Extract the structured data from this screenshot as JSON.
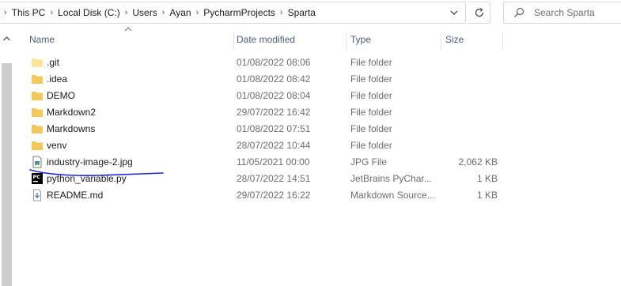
{
  "address_bar": {
    "crumbs": [
      "This PC",
      "Local Disk (C:)",
      "Users",
      "Ayan",
      "PycharmProjects",
      "Sparta"
    ]
  },
  "search": {
    "placeholder": "Search Sparta"
  },
  "columns": {
    "name": "Name",
    "date": "Date modified",
    "type": "Type",
    "size": "Size"
  },
  "files": [
    {
      "name": ".git",
      "date": "01/08/2022 08:06",
      "type": "File folder",
      "size": "",
      "icon": "folder-icon"
    },
    {
      "name": ".idea",
      "date": "01/08/2022 08:42",
      "type": "File folder",
      "size": "",
      "icon": "folder-icon"
    },
    {
      "name": "DEMO",
      "date": "01/08/2022 08:04",
      "type": "File folder",
      "size": "",
      "icon": "folder-icon"
    },
    {
      "name": "Markdown2",
      "date": "29/07/2022 16:42",
      "type": "File folder",
      "size": "",
      "icon": "folder-icon"
    },
    {
      "name": "Markdowns",
      "date": "01/08/2022 07:51",
      "type": "File folder",
      "size": "",
      "icon": "folder-icon"
    },
    {
      "name": "venv",
      "date": "28/07/2022 10:44",
      "type": "File folder",
      "size": "",
      "icon": "folder-icon"
    },
    {
      "name": "industry-image-2.jpg",
      "date": "11/05/2021 00:00",
      "type": "JPG File",
      "size": "2,062 KB",
      "icon": "image-file-icon"
    },
    {
      "name": "python_variable.py",
      "date": "28/07/2022 14:51",
      "type": "JetBrains PyChar...",
      "size": "1 KB",
      "icon": "pycharm-file-icon"
    },
    {
      "name": "README.md",
      "date": "29/07/2022 16:22",
      "type": "Markdown Source...",
      "size": "1 KB",
      "icon": "markdown-file-icon"
    }
  ],
  "colors": {
    "folder": "#f2c75c",
    "header_text": "#4c607a",
    "pen": "#1a2bd6"
  }
}
